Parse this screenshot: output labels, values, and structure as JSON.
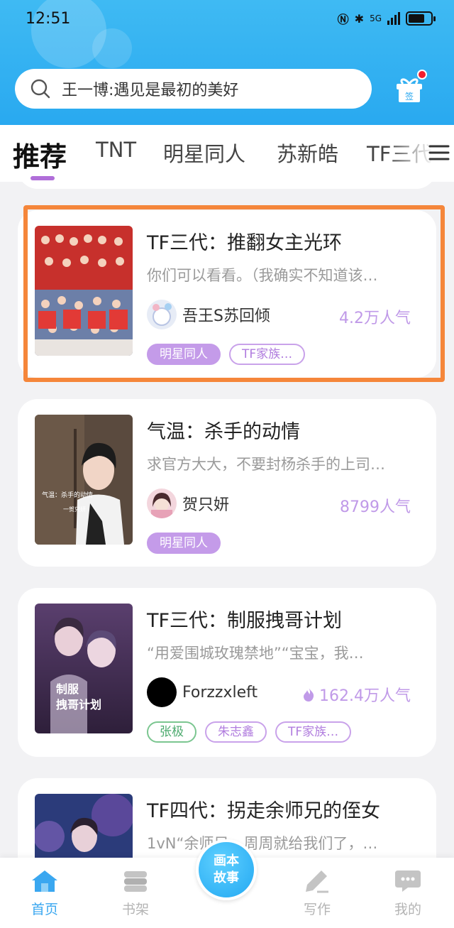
{
  "status_bar": {
    "time": "12:51",
    "network": "5G"
  },
  "search": {
    "text": "王一博:遇见是最初的美好"
  },
  "gift": {
    "label": "签"
  },
  "tabs": [
    "推荐",
    "TNT",
    "明星同人",
    "苏新皓",
    "TF三代"
  ],
  "stories": [
    {
      "title": "TF三代：推翻女主光环",
      "desc": "你们可以看看。（我确实不知道该…",
      "author": "吾王S苏回倾",
      "popularity": "4.2万人气",
      "tags": [
        {
          "text": "明星同人",
          "style": "filled"
        },
        {
          "text": "TF家族…",
          "style": "outline"
        }
      ]
    },
    {
      "title": "气温：杀手的动情",
      "desc": "求官方大大，不要封杨杀手的上司…",
      "author": "贺只妍",
      "popularity": "8799人气",
      "cover_caption": "气温：杀手的动情",
      "cover_caption2": "一贺只妍",
      "tags": [
        {
          "text": "明星同人",
          "style": "filled"
        }
      ]
    },
    {
      "title": "TF三代：制服拽哥计划",
      "desc": "“用爱围城玫瑰禁地”“宝宝，我…",
      "author": "Forzzxleft",
      "popularity": "162.4万人气",
      "cover_caption": "制服\n拽哥计划",
      "tags": [
        {
          "text": "张极",
          "style": "green"
        },
        {
          "text": "朱志鑫",
          "style": "outline"
        },
        {
          "text": "TF家族…",
          "style": "outline"
        }
      ]
    },
    {
      "title": "TF四代：拐走余师兄的侄女",
      "desc": "1vN“余师兄，周周就给我们了，…"
    }
  ],
  "bottom_nav": {
    "home": "首页",
    "shelf": "书架",
    "center": [
      "画本",
      "故事"
    ],
    "write": "写作",
    "me": "我的"
  },
  "colors": {
    "header": "#29a9f0",
    "accent": "#b06ed9",
    "highlight": "#f5863a",
    "nav_active": "#3aa7f0"
  }
}
